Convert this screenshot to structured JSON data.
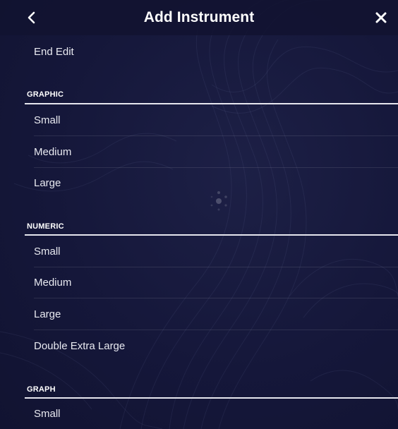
{
  "header": {
    "title": "Add Instrument",
    "back_icon": "chevron-left-icon",
    "close_icon": "close-icon"
  },
  "end_edit": {
    "label": "End Edit"
  },
  "sections": [
    {
      "title": "GRAPHIC",
      "items": [
        "Small",
        "Medium",
        "Large"
      ]
    },
    {
      "title": "NUMERIC",
      "items": [
        "Small",
        "Medium",
        "Large",
        "Double Extra Large"
      ]
    },
    {
      "title": "GRAPH",
      "items": [
        "Small"
      ]
    }
  ],
  "colors": {
    "background": "#161836",
    "text": "#ffffff",
    "section_line": "#e6e6ee"
  },
  "loading_indicator": "spinner-icon"
}
